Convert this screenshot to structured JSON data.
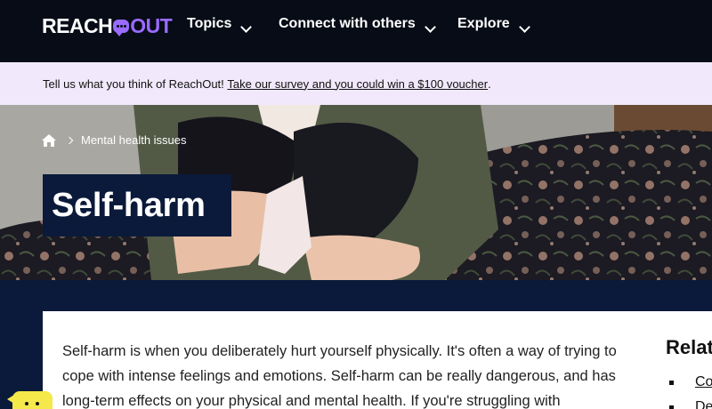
{
  "header": {
    "logo_reach": "REACH",
    "logo_out": "OUT",
    "nav": [
      {
        "label": "Topics",
        "icon": "chevron-down-icon"
      },
      {
        "label": "Connect with others",
        "icon": "chevron-down-icon"
      },
      {
        "label": "Explore",
        "icon": "chevron-down-icon"
      }
    ]
  },
  "banner": {
    "text": "Tell us what you think of ReachOut! ",
    "link": "Take our survey and you could win a $100 voucher",
    "suffix": "."
  },
  "breadcrumb": {
    "home_icon": "home-icon",
    "item": "Mental health issues"
  },
  "hero": {
    "title": "Self-harm"
  },
  "content": {
    "intro": "Self-harm is when you deliberately hurt yourself physically. It's often a way of trying to cope with intense feelings and emotions. Self-harm can be really dangerous, and has long-term effects on your physical and mental health. If you're struggling with"
  },
  "related": {
    "title": "Relat",
    "items": [
      "Co",
      "De"
    ]
  },
  "colors": {
    "nav_bg": "#070c17",
    "accent_purple": "#9a6bff",
    "banner_bg": "#f1e9fb",
    "navy": "#0b1a3a",
    "chatbot_yellow": "#f4e84a"
  }
}
